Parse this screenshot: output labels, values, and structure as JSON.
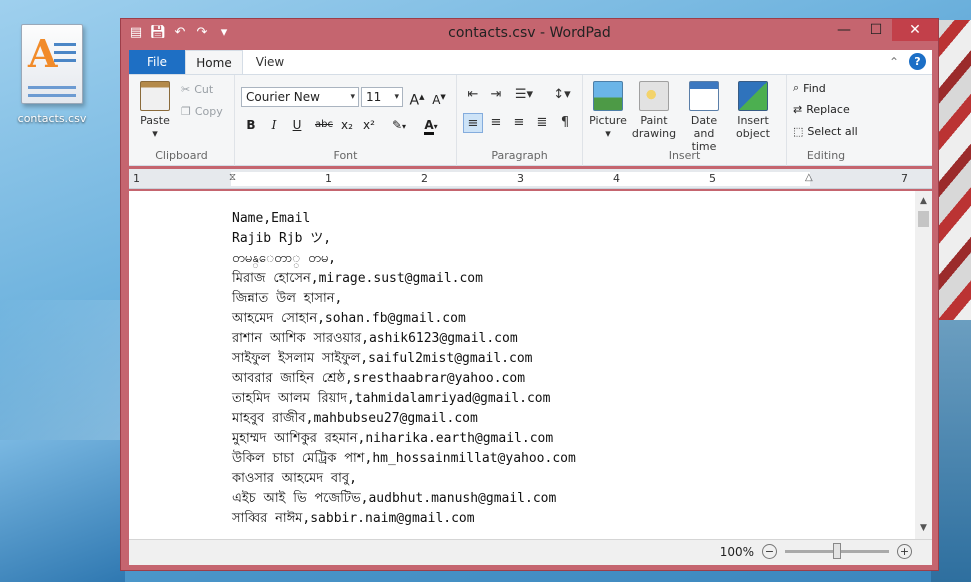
{
  "desktop": {
    "icon_label": "contacts.csv"
  },
  "window": {
    "title": "contacts.csv - WordPad",
    "minimize": "—",
    "maximize": "☐",
    "close": "✕"
  },
  "tabs": {
    "file": "File",
    "home": "Home",
    "view": "View"
  },
  "ribbon": {
    "clipboard": {
      "paste": "Paste",
      "cut": "Cut",
      "copy": "Copy",
      "label": "Clipboard"
    },
    "font": {
      "family": "Courier New",
      "size": "11",
      "grow": "A",
      "shrink": "A",
      "bold": "B",
      "italic": "I",
      "underline": "U",
      "strikethrough": "abc",
      "subscript": "x₂",
      "superscript": "x²",
      "color": "A",
      "label": "Font"
    },
    "paragraph": {
      "label": "Paragraph"
    },
    "insert": {
      "picture": "Picture",
      "paint_line1": "Paint",
      "paint_line2": "drawing",
      "date_line1": "Date and",
      "date_line2": "time",
      "object_line1": "Insert",
      "object_line2": "object",
      "label": "Insert"
    },
    "editing": {
      "find": "Find",
      "replace": "Replace",
      "select_all": "Select all",
      "label": "Editing"
    }
  },
  "ruler": {
    "numbers": [
      "1",
      "1",
      "2",
      "3",
      "4",
      "5",
      "6",
      "7"
    ]
  },
  "document": {
    "lines": [
      "Name,Email",
      "Rajib Rjb ツ,",
      "တမန္ေတာ္ တမ,",
      "মিরাজ হোসেন,mirage.sust@gmail.com",
      "জিন্নাত উল হাসান,",
      "আহমেদ সোহান,sohan.fb@gmail.com",
      "রাশান আশিক সারওয়ার,ashik6123@gmail.com",
      "সাইফুল ইসলাম সাইফুল,saiful2mist@gmail.com",
      "আবরার জাহিন শ্রেষ্ঠ,sresthaabrar@yahoo.com",
      "তাহমিদ আলম রিয়াদ,tahmidalamriyad@gmail.com",
      "মাহবুব রাজীব,mahbubseu27@gmail.com",
      "মুহাম্মদ আশিকুর রহমান,niharika.earth@gmail.com",
      "উকিল চাচা মেট্রিক পাশ,hm_hossainmillat@yahoo.com",
      "কাওসার আহমেদ বাবু,",
      "এইচ আই ভি পজেটিভ,audbhut.manush@gmail.com",
      "সাব্বির নাঈম,sabbir.naim@gmail.com"
    ]
  },
  "status": {
    "zoom_level": "100%"
  },
  "colors": {
    "window_frame": "#c5656f",
    "file_tab": "#1e6fc4",
    "close_button": "#c2404a"
  }
}
